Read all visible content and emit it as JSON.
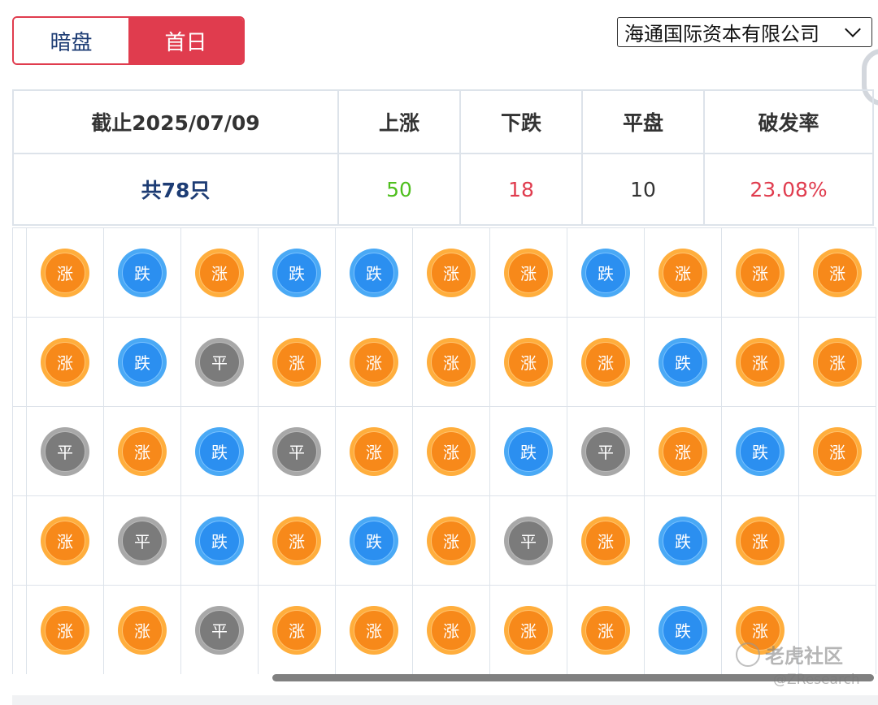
{
  "tabs": [
    {
      "label": "暗盘",
      "active": false
    },
    {
      "label": "首日",
      "active": true
    }
  ],
  "broker_select": {
    "value": "海通国际资本有限公司"
  },
  "summary": {
    "headers": [
      "截止2025/07/09",
      "上涨",
      "下跌",
      "平盘",
      "破发率"
    ],
    "total": "共78只",
    "up": "50",
    "down": "18",
    "flat": "10",
    "break_rate": "23.08%"
  },
  "legend_labels": {
    "up": "涨",
    "down": "跌",
    "flat": "平"
  },
  "colors": {
    "accent_red": "#e03c4e",
    "up_green": "#4fbf1e",
    "navy": "#1d3c74",
    "coin_up": "#f7891a",
    "coin_down": "#2b8ff0",
    "coin_flat": "#7b7b7b"
  },
  "grid_rows": [
    [
      "up",
      "down",
      "up",
      "down",
      "down",
      "up",
      "up",
      "down",
      "up",
      "up",
      "up"
    ],
    [
      "up",
      "down",
      "flat",
      "up",
      "up",
      "up",
      "up",
      "up",
      "down",
      "up",
      "up"
    ],
    [
      "flat",
      "up",
      "down",
      "flat",
      "up",
      "up",
      "down",
      "flat",
      "up",
      "down",
      "up"
    ],
    [
      "up",
      "flat",
      "down",
      "up",
      "down",
      "up",
      "flat",
      "up",
      "down",
      "up",
      ""
    ],
    [
      "up",
      "up",
      "flat",
      "up",
      "up",
      "up",
      "up",
      "up",
      "down",
      "up",
      ""
    ]
  ],
  "watermark": {
    "name": "老虎社区",
    "handle": "@ZResearch"
  }
}
